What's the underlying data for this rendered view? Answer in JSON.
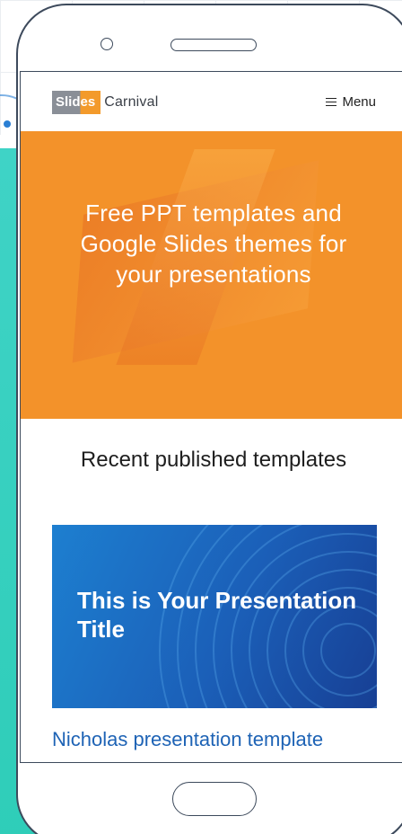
{
  "header": {
    "logo_part1": "Slides",
    "logo_part2": "Carnival",
    "menu_label": "Menu"
  },
  "hero": {
    "title": "Free PPT templates and Google Slides themes for your presentations",
    "background_color": "#f3922a"
  },
  "recent": {
    "heading": "Recent published templates",
    "items": [
      {
        "thumbnail_title": "This is Your Presentation Title",
        "name": "Nicholas presentation template"
      }
    ]
  },
  "colors": {
    "accent_orange": "#f3922a",
    "link_blue": "#1e63b5",
    "teal": "#2ecdb8"
  },
  "icons": [
    "hamburger-icon"
  ]
}
